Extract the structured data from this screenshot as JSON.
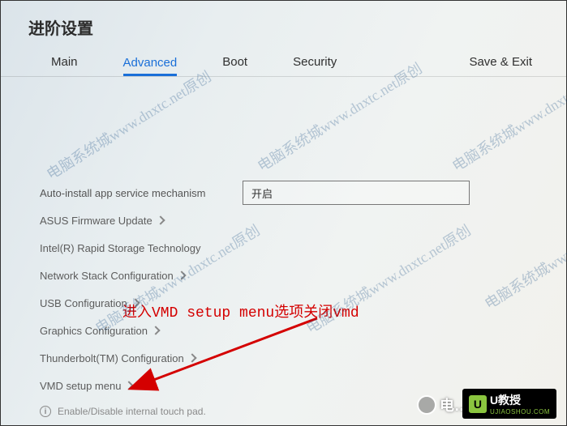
{
  "title": "进阶设置",
  "tabs": {
    "main": "Main",
    "advanced": "Advanced",
    "boot": "Boot",
    "security": "Security",
    "save_exit": "Save & Exit"
  },
  "items": {
    "auto_install": {
      "label": "Auto-install app service mechanism",
      "value": "开启"
    },
    "asus_fw": "ASUS Firmware Update",
    "irst": "Intel(R) Rapid Storage Technology",
    "netstack": "Network Stack Configuration",
    "usb": "USB Configuration",
    "graphics": "Graphics Configuration",
    "thunderbolt": "Thunderbolt(TM) Configuration",
    "vmd": "VMD setup menu"
  },
  "hint": {
    "icon": "i",
    "text": "Enable/Disable internal touch pad."
  },
  "annotation": "进入VMD setup menu选项关闭vmd",
  "watermark": "电脑系统城www.dnxtc.net原创",
  "brand1": "电…",
  "brand2": {
    "u": "U",
    "name": "U教授",
    "sub": "UJIAOSHOU.COM"
  }
}
